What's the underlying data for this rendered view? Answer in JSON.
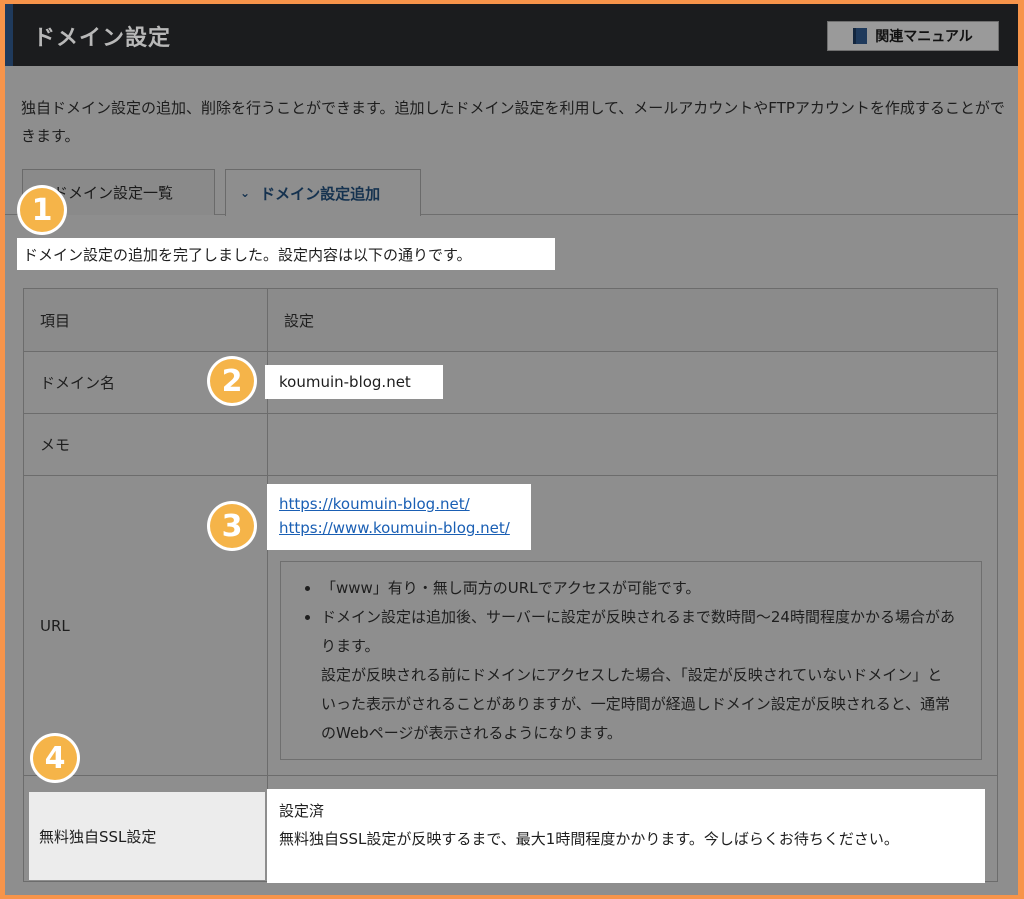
{
  "header": {
    "title": "ドメイン設定",
    "manual_button": "関連マニュアル"
  },
  "intro_text": "独自ドメイン設定の追加、削除を行うことができます。追加したドメイン設定を利用して、メールアカウントやFTPアカウントを作成することができます。",
  "tabs": [
    {
      "label": "ドメイン設定一覧"
    },
    {
      "label": "ドメイン設定追加",
      "active": true
    }
  ],
  "completion_message": "ドメイン設定の追加を完了しました。設定内容は以下の通りです。",
  "table": {
    "header_item": "項目",
    "header_setting": "設定",
    "rows": [
      {
        "label": "ドメイン名",
        "value": "koumuin-blog.net"
      },
      {
        "label": "メモ",
        "value": ""
      },
      {
        "label": "URL",
        "urls": [
          "https://koumuin-blog.net/",
          "https://www.koumuin-blog.net/"
        ]
      },
      {
        "label": "無料独自SSL設定",
        "status": "設定済",
        "detail": "無料独自SSL設定が反映するまで、最大1時間程度かかります。今しばらくお待ちください。"
      }
    ]
  },
  "url_notes": [
    "「www」有り・無し両方のURLでアクセスが可能です。",
    "ドメイン設定は追加後、サーバーに設定が反映されるまで数時間～24時間程度かかる場合があります。",
    "設定が反映される前にドメインにアクセスした場合、「設定が反映されていないドメイン」といった表示がされることがありますが、一定時間が経過しドメイン設定が反映されると、通常のWebページが表示されるようになります。"
  ],
  "badges": [
    "1",
    "2",
    "3",
    "4"
  ],
  "colors": {
    "frame_border": "#f7944a",
    "badge": "#f5b449",
    "link": "#1a5fb4",
    "header_bg": "#1b1c1e"
  }
}
